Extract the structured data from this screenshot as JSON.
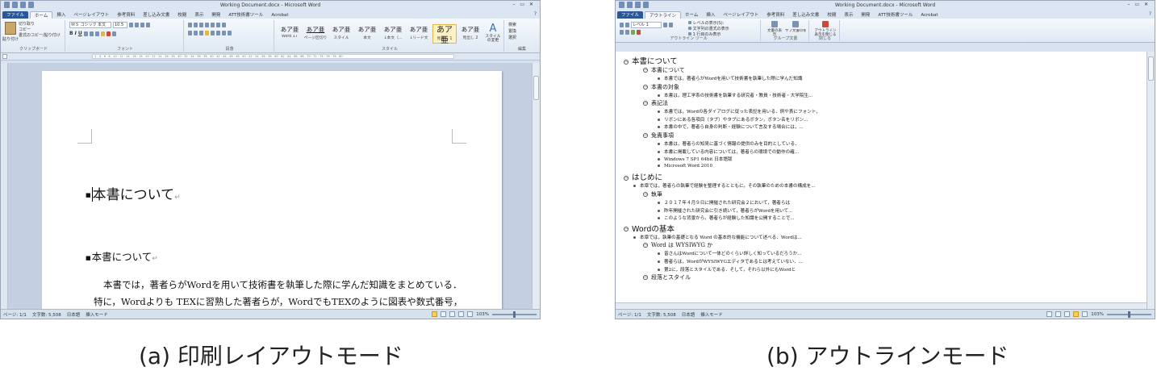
{
  "window": {
    "title": "Working Document.docx - Microsoft Word",
    "controls": "– ▭ ✕"
  },
  "tabs_a": [
    "ファイル",
    "ホーム",
    "挿入",
    "ページレイアウト",
    "参考資料",
    "差し込み文書",
    "校閲",
    "表示",
    "開発",
    "ATT技術書ツール",
    "Acrobat"
  ],
  "tabs_b": [
    "ファイル",
    "アウトライン",
    "ホーム",
    "挿入",
    "ページレイアウト",
    "参考資料",
    "差し込み文書",
    "校閲",
    "表示",
    "開発",
    "ATT技術書ツール",
    "Acrobat"
  ],
  "ribbon_a": {
    "clipboard": {
      "paste": "貼り付け",
      "cut": "切り取り",
      "copy": "コピー",
      "format": "書式のコピー/貼り付け",
      "label": "クリップボード"
    },
    "font": {
      "name": "ＭＳ ゴシック 本文",
      "size": "10.5",
      "label": "フォント"
    },
    "paragraph_label": "段落",
    "styles": [
      {
        "sample": "あア亜",
        "name": "Word 17"
      },
      {
        "sample": "あア亜",
        "name": "ページ区切り"
      },
      {
        "sample": "あア亜",
        "name": "スタイル"
      },
      {
        "sample": "あア亜",
        "name": "本文"
      },
      {
        "sample": "あア亜",
        "name": "↓本文（..."
      },
      {
        "sample": "あア亜",
        "name": "↓リード文"
      },
      {
        "sample": "あア亜",
        "name": "見出し 1"
      },
      {
        "sample": "あア亜",
        "name": "見出し 2"
      }
    ],
    "style_label": "スタイル",
    "change_styles": "スタイルの変更",
    "editing": {
      "find": "検索",
      "replace": "置換",
      "select": "選択",
      "label": "編集"
    }
  },
  "ribbon_b": {
    "level": "レベル 1",
    "show_level": "レベルの表示(S):",
    "show_text_format": "文字列の書式の表示",
    "first_line_only": "1 行目のみ表示",
    "outline_tools_label": "アウトライン ツール",
    "show_document": "文書の表示",
    "collapse_subdocs": "サブ文書の折りたたみ",
    "master_doc_label": "グループ文書",
    "close_outline": "アウトライン表示を閉じる",
    "close_label": "閉じる"
  },
  "doc_a": {
    "heading1": "本書について",
    "heading2": "本書について",
    "body_line1": "本書では，著者らがWordを用いて技術書を執筆した際に学んだ知識をまとめている．",
    "body_line2": "特に，Wordよりも TEXに習熟した著者らが，WordでもTEXのように図表や数式番号，"
  },
  "outline": [
    {
      "level": 1,
      "mark": "circle",
      "text": "本書について"
    },
    {
      "level": 2,
      "mark": "circle",
      "text": "本書について"
    },
    {
      "level": 3,
      "mark": "dot",
      "text": "本書では，著者らがWordを用いて技術書を執筆した際に学んだ知識"
    },
    {
      "level": 2,
      "mark": "circle",
      "text": "本書の対象"
    },
    {
      "level": 3,
      "mark": "dot",
      "text": "本書は，理工学系の技術書を執筆する研究者・教員・技術者・大学院生..."
    },
    {
      "level": 2,
      "mark": "circle",
      "text": "表記法"
    },
    {
      "level": 3,
      "mark": "dot",
      "text": "本書では，Wordの各ダイアログに従った表記を用いる．例や表にフォント，書..."
    },
    {
      "level": 3,
      "mark": "dot",
      "text": "リボンにある各項目（タブ）やタブにあるボタン，ボタン名をリボン..."
    },
    {
      "level": 3,
      "mark": "dot",
      "text": "本書の中で，著者ら自身の判断・経験について言及する場合には，..."
    },
    {
      "level": 2,
      "mark": "circle",
      "text": "免責事項"
    },
    {
      "level": 3,
      "mark": "dot",
      "text": "本書は，著者らの知見に基づく情報の提供のみを目的としている．"
    },
    {
      "level": 3,
      "mark": "dot",
      "text": "本書に掲載している内容については，著者らの環境での動作の確..."
    },
    {
      "level": 3,
      "mark": "dot",
      "text": "Windows 7 SP1 64bit 日本語版"
    },
    {
      "level": 3,
      "mark": "dot",
      "text": "Microsoft Word 2010"
    },
    {
      "level": 1,
      "mark": "circle",
      "text": "はじめに"
    },
    {
      "level": 2,
      "mark": "dot",
      "text": "本章では，著者らの執筆で経験を整理するとともに，その執筆のための本書の構成を..."
    },
    {
      "level": 2,
      "mark": "circle",
      "text": "執筆"
    },
    {
      "level": 3,
      "mark": "dot",
      "text": "２０１７年４月９日に開催された研究会２において，著者らは"
    },
    {
      "level": 3,
      "mark": "dot",
      "text": "昨年開催された研究会に引き続いて，著者らがWordを用いて..."
    },
    {
      "level": 3,
      "mark": "dot",
      "text": "このような背景から，著者らが経験した知識を公開することで..."
    },
    {
      "level": 1,
      "mark": "circle",
      "text": "Wordの基本"
    },
    {
      "level": 2,
      "mark": "dot",
      "text": "本章では，執筆の基礎となる Word の基本的な機能について述べる．Wordは..."
    },
    {
      "level": 2,
      "mark": "circle",
      "text": "Word は WYSIWYG か"
    },
    {
      "level": 3,
      "mark": "dot",
      "text": "皆さんはWordについて一体どのくらい詳しく知っているだろうか..."
    },
    {
      "level": 3,
      "mark": "dot",
      "text": "著者らは，WordがWYSIWYGエディタであるとは考えていない．..."
    },
    {
      "level": 3,
      "mark": "dot",
      "text": "第2に，段落とスタイルである．そして，それら以外にもWordと"
    },
    {
      "level": 2,
      "mark": "circle",
      "text": "段落とスタイル"
    }
  ],
  "status": {
    "page": "ページ: 1/1",
    "words": "文字数: 5,508",
    "lang": "日本語",
    "mode": "挿入モード",
    "zoom": "103%"
  },
  "captions": {
    "a": "(a) 印刷レイアウトモード",
    "b": "(b) アウトラインモード"
  }
}
